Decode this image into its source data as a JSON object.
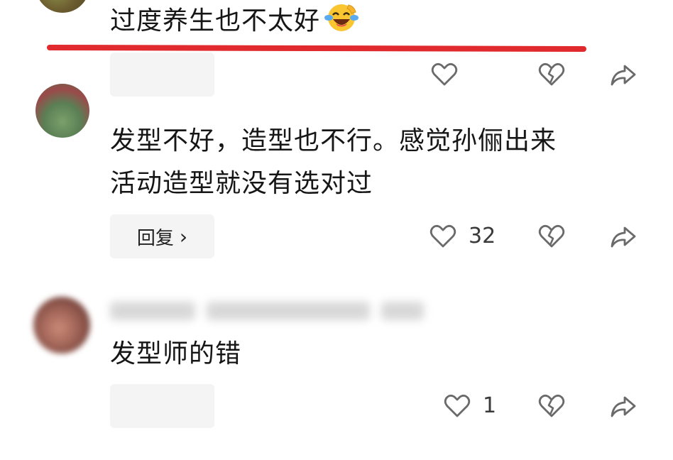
{
  "comments": [
    {
      "text": "过度养生也不太好",
      "reply_label": "",
      "like_count": ""
    },
    {
      "text_line1": "发型不好，造型也不行。感觉孙俪出来",
      "text_line2": "活动造型就没有选对过",
      "reply_label": "回复",
      "reply_chevron": "›",
      "like_count": "32"
    },
    {
      "text": "发型师的错",
      "reply_label": "",
      "like_count": "1"
    }
  ],
  "icons": {
    "like": "heart-outline-icon",
    "dislike": "broken-heart-icon",
    "share": "share-arrow-icon",
    "emoji": "laughing-crying-emoji"
  },
  "colors": {
    "underline": "#e12a2d",
    "icon": "#6a6a6a",
    "reply_bg": "#f4f4f4"
  }
}
